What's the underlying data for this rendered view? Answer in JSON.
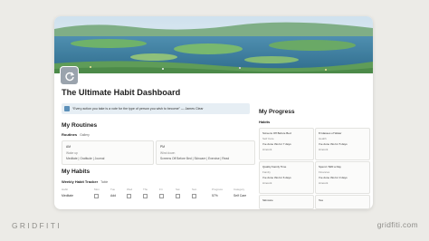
{
  "page": {
    "title": "The Ultimate Habit Dashboard",
    "quote": "“Every action you take is a vote for the type of person you wish to become” — James Clear"
  },
  "routines": {
    "heading": "My Routines",
    "sub_label": "Routines",
    "view_label": "Gallery",
    "am": {
      "label": "AM",
      "line2": "Wake up",
      "line3": "Meditate | Gratitude | Journal"
    },
    "pm": {
      "label": "PM",
      "line2": "Wind down",
      "line3": "Screens Off Before Bed | Skincare | Exercise | Read"
    }
  },
  "habits": {
    "heading": "My Habits",
    "tracker_label": "Weekly Habit Tracker",
    "view_label": "Table",
    "columns": [
      "Habit",
      "Mon",
      "Tue",
      "Wed",
      "Thu",
      "Fri",
      "Sat",
      "Sun",
      "Progress",
      "Category"
    ],
    "row": {
      "habit": "Meditate",
      "mon": "",
      "tue": "Add",
      "progress": "57%",
      "category": "Self Care"
    }
  },
  "progress": {
    "heading": "My Progress",
    "sub_label": "Habits",
    "cards": [
      {
        "title": "Screens Off Before Bed",
        "tag": "Self Care",
        "line": "I've done this for 7 days",
        "amount": "Amount"
      },
      {
        "title": "8 Glasses of Water",
        "tag": "Health",
        "line": "I've done this for 5 days",
        "amount": "Amount"
      },
      {
        "title": "Quality Family Time",
        "tag": "Family",
        "line": "I've done this for 6 days",
        "amount": "Amount"
      },
      {
        "title": "Spend <$30 a Day",
        "tag": "Finances",
        "line": "I've done this for 3 days",
        "amount": "Amount"
      },
      {
        "title": "Skincare",
        "tag": "",
        "line": "",
        "amount": ""
      },
      {
        "title": "Tea",
        "tag": "",
        "line": "",
        "amount": ""
      }
    ]
  },
  "watermark": {
    "left": "GRIDFITI",
    "right": "gridfiti.com"
  },
  "colors": {
    "background": "#ecebe7",
    "callout": "#e6eef4",
    "watermark": "#8d8c88"
  }
}
